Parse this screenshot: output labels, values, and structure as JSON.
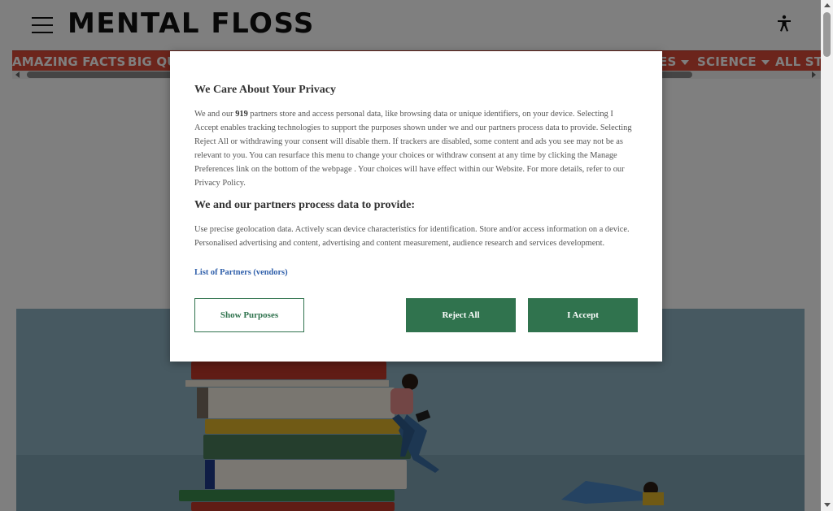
{
  "header": {
    "logo_text": "MENTAL FLOSS",
    "menu_icon": "hamburger-menu-icon",
    "accessibility_icon": "accessibility-person-icon"
  },
  "nav": {
    "items": [
      {
        "label": "AMAZING FACTS",
        "has_dropdown": false
      },
      {
        "label": "BIG QU",
        "has_dropdown": false
      },
      {
        "label": "ES",
        "has_dropdown": true
      },
      {
        "label": "SCIENCE",
        "has_dropdown": true
      },
      {
        "label": "ALL STO",
        "has_dropdown": false
      }
    ],
    "color": "#d94b39"
  },
  "privacy_modal": {
    "title": "We Care About Your Privacy",
    "body_prefix": "We and our ",
    "partner_count": "919",
    "body_suffix": " partners store and access personal data, like browsing data or unique identifiers, on your device. Selecting I Accept enables tracking technologies to support the purposes shown under we and our partners process data to provide. Selecting Reject All or withdrawing your consent will disable them. If trackers are disabled, some content and ads you see may not be as relevant to you. You can resurface this menu to change your choices or withdraw consent at any time by clicking the Manage Preferences link on the bottom of the webpage . Your choices will have effect within our Website. For more details, refer to our Privacy Policy.",
    "subtitle": "We and our partners process data to provide:",
    "purposes_text": "Use precise geolocation data. Actively scan device characteristics for identification. Store and/or access information on a device. Personalised advertising and content, advertising and content measurement, audience research and services development.",
    "partners_link": "List of Partners (vendors)",
    "show_purposes_label": "Show Purposes",
    "reject_label": "Reject All",
    "accept_label": "I Accept",
    "button_color": "#30734e"
  }
}
